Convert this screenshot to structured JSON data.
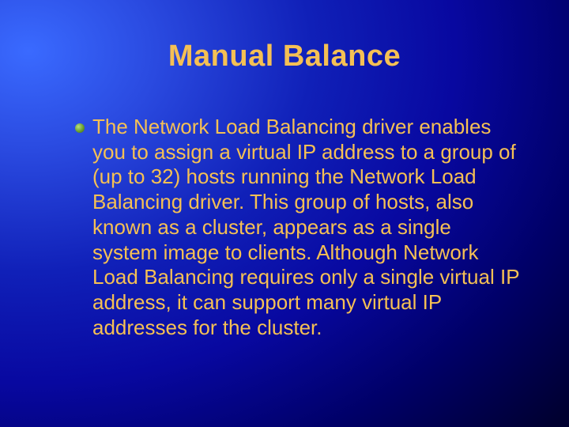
{
  "slide": {
    "title": "Manual Balance",
    "bullets": [
      "The Network Load Balancing driver enables you to assign a virtual IP address to a group of (up to 32) hosts running the Network Load Balancing driver. This group of hosts, also known as a cluster, appears as a single system image to clients. Although Network Load Balancing requires only a single virtual IP address, it can support many virtual IP addresses for the cluster."
    ]
  }
}
